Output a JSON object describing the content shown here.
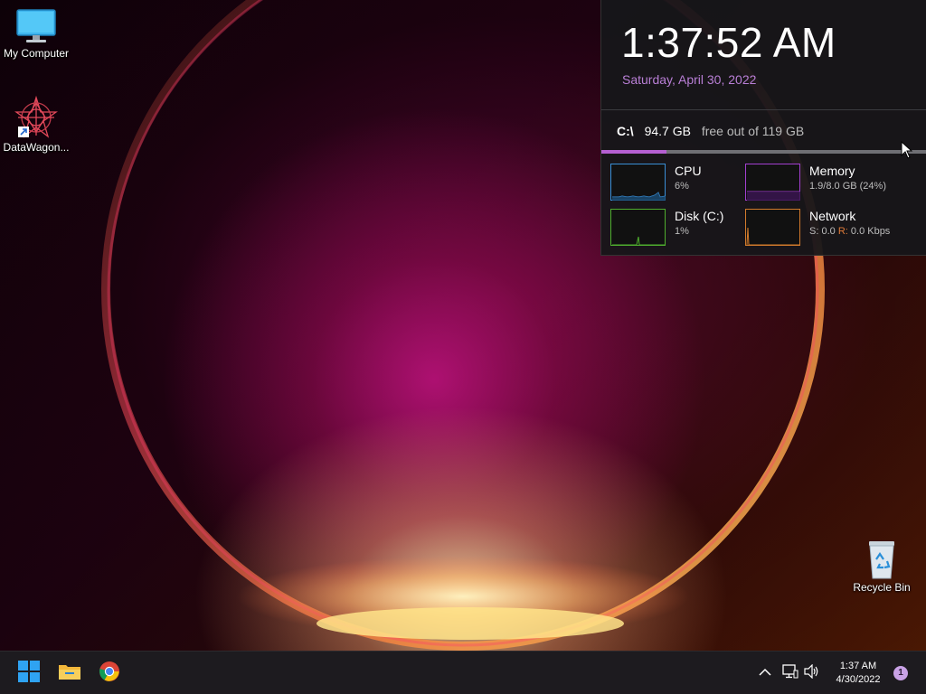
{
  "desktop": {
    "icons": [
      {
        "label": "My Computer",
        "icon": "monitor-icon"
      },
      {
        "label": "DataWagon...",
        "icon": "datawagon-star-icon"
      },
      {
        "label": "Recycle Bin",
        "icon": "recycle-bin-icon"
      }
    ]
  },
  "widget": {
    "clock_time": "1:37:52 AM",
    "clock_date": "Saturday, April 30, 2022",
    "drive": {
      "letter": "C:\\",
      "free": "94.7 GB",
      "total_text": "free out of 119 GB",
      "used_fraction": 0.2
    },
    "meters": {
      "cpu": {
        "title": "CPU",
        "value": "6%",
        "color": "#3a8fd6"
      },
      "memory": {
        "title": "Memory",
        "value": "1.9/8.0 GB (24%)",
        "color": "#a23fd0"
      },
      "disk": {
        "title": "Disk (C:)",
        "value": "1%",
        "color": "#4fae2e"
      },
      "network": {
        "title": "Network",
        "send_label": "S:",
        "send_value": "0.0",
        "recv_label": "R:",
        "recv_value": "0.0 Kbps",
        "color": "#d17a2c"
      }
    }
  },
  "taskbar": {
    "buttons": [
      {
        "name": "start-button",
        "icon": "windows-logo-icon"
      },
      {
        "name": "file-explorer-button",
        "icon": "folder-icon"
      },
      {
        "name": "chrome-button",
        "icon": "chrome-icon"
      }
    ],
    "tray": {
      "time": "1:37 AM",
      "date": "4/30/2022",
      "notification_count": "1"
    }
  },
  "colors": {
    "accent": "#b55fd1",
    "date_text": "#b97fd6",
    "taskbar_bg": "#1d1b1f"
  }
}
